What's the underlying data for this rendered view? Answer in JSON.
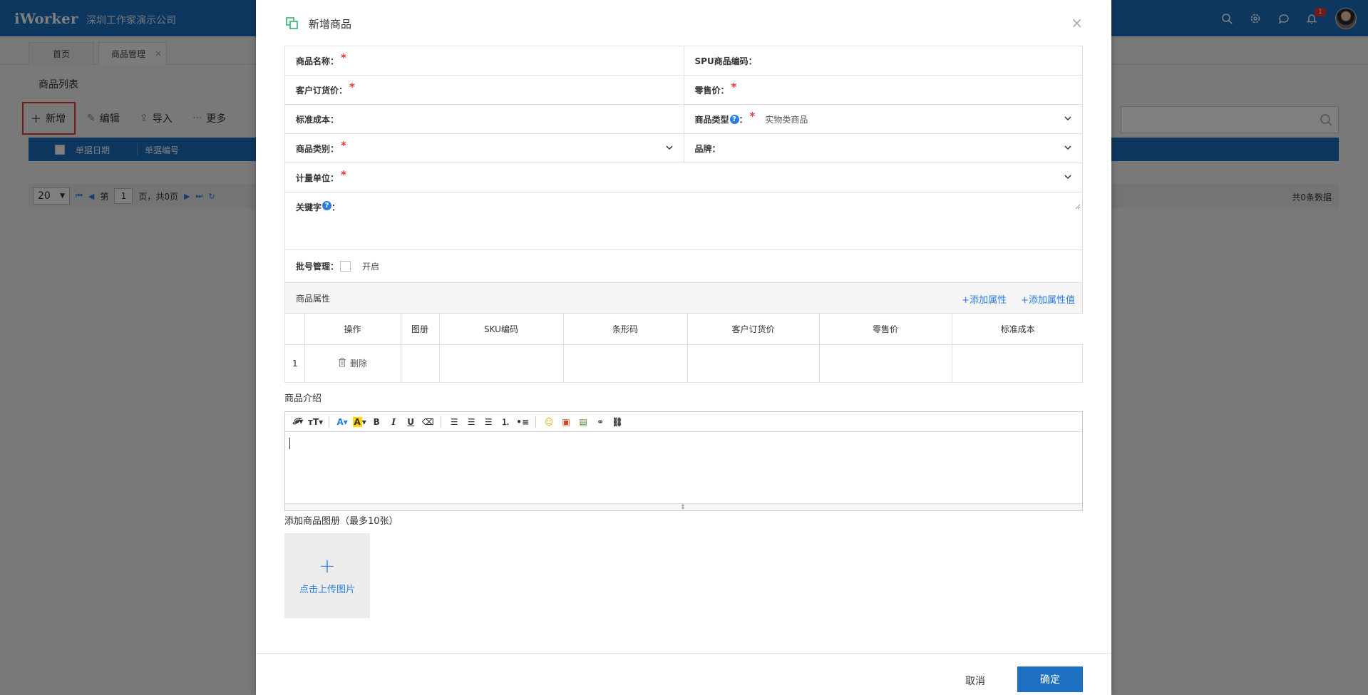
{
  "app": {
    "logo": "iWorker",
    "company": "深圳工作家演示公司",
    "notification_count": "1"
  },
  "tabs": [
    {
      "label": "首页"
    },
    {
      "label": "商品管理",
      "close": "×"
    }
  ],
  "list": {
    "title": "商品列表",
    "toolbar": {
      "add": "新增",
      "edit": "编辑",
      "import": "导入",
      "more": "更多"
    },
    "columns": [
      "单据日期",
      "单据编号"
    ],
    "pager": {
      "page_size": "20",
      "page_prefix": "第",
      "page": "1",
      "page_suffix": "页，共0页",
      "total": "共0条数据"
    }
  },
  "modal": {
    "title": "新增商品",
    "close": "×",
    "fields": {
      "name": "商品名称：",
      "spu": "SPU商品编码：",
      "customer_price": "客户订货价：",
      "retail_price": "零售价：",
      "std_cost": "标准成本：",
      "type": "商品类型",
      "type_colon": "：",
      "type_value": "实物类商品",
      "category": "商品类别：",
      "brand": "品牌：",
      "unit": "计量单位：",
      "keywords": "关键字",
      "keywords_colon": "：",
      "batch": "批号管理：",
      "batch_option": "开启"
    },
    "required_mark": "*",
    "help_mark": "?",
    "attributes": {
      "title": "商品属性",
      "add_attr": "+添加属性",
      "add_value": "+添加属性值",
      "columns": [
        "操作",
        "图册",
        "SKU编码",
        "条形码",
        "客户订货价",
        "零售价",
        "标准成本"
      ],
      "rows": [
        {
          "index": "1",
          "action": "删除"
        }
      ]
    },
    "intro_label": "商品介绍",
    "album_label": "添加商品图册（最多10张）",
    "upload_label": "点击上传图片",
    "cancel": "取消",
    "ok": "确定"
  },
  "colors": {
    "primary": "#1d6fc0",
    "link": "#2a7de1",
    "required": "#e53935",
    "highlight_border": "#e53935"
  }
}
